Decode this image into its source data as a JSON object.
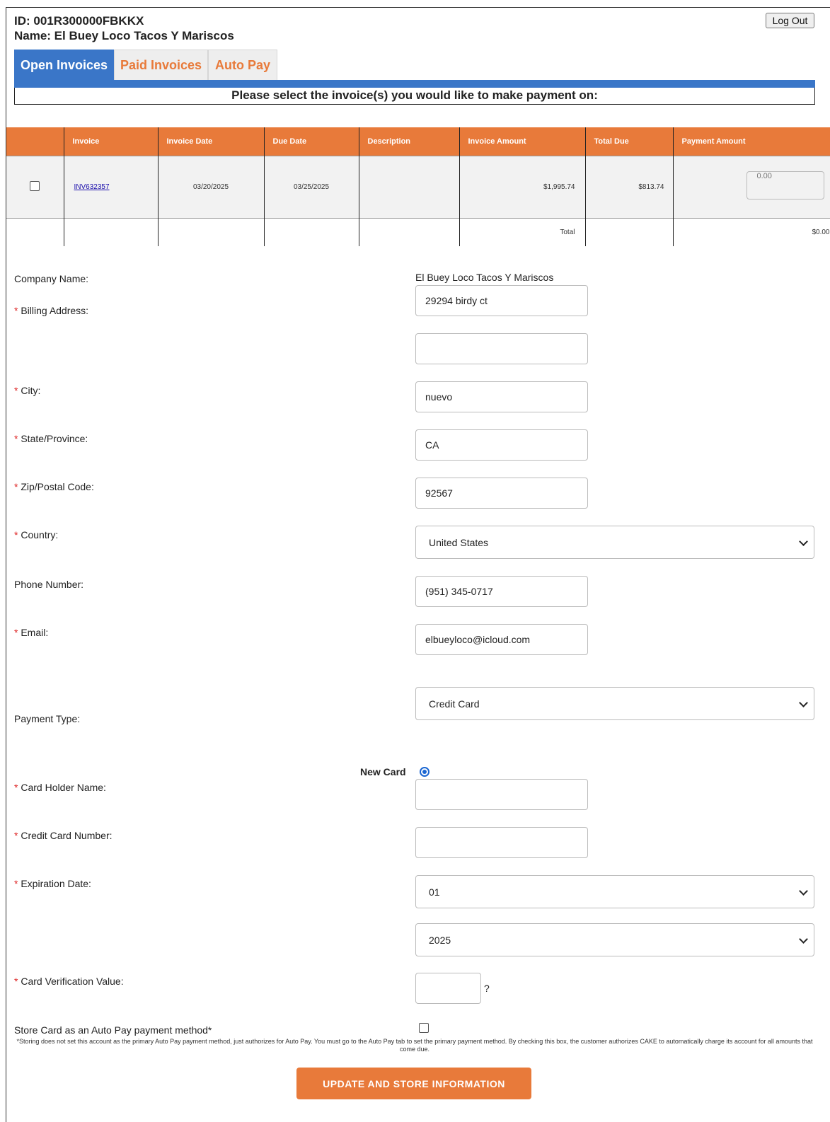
{
  "header": {
    "id_text": "ID: 001R300000FBKKX",
    "name_text": "Name: El Buey Loco Tacos Y Mariscos",
    "logout_label": "Log Out"
  },
  "tabs": [
    {
      "label": "Open Invoices",
      "active": true
    },
    {
      "label": "Paid Invoices",
      "active": false
    },
    {
      "label": "Auto Pay",
      "active": false
    }
  ],
  "instruction": "Please select the invoice(s) you would like to make payment on:",
  "invoice_table": {
    "columns": [
      "Invoice",
      "Invoice Date",
      "Due Date",
      "Description",
      "Invoice Amount",
      "Total Due",
      "Payment Amount"
    ],
    "rows": [
      {
        "invoice": "INV632357",
        "invoice_date": "03/20/2025",
        "due_date": "03/25/2025",
        "description": "",
        "invoice_amount": "$1,995.74",
        "total_due": "$813.74",
        "payment_amount": "0.00",
        "selected": false
      }
    ],
    "total_label": "Total",
    "total_value": "$0.00"
  },
  "form": {
    "company_name_label": "Company Name:",
    "company_name_value": "El Buey Loco Tacos Y Mariscos",
    "required_mark": "*",
    "billing_address_label": "Billing Address:",
    "billing_address_1": "29294 birdy ct",
    "billing_address_2": "",
    "city_label": "City:",
    "city_value": "nuevo",
    "state_label": "State/Province:",
    "state_value": "CA",
    "zip_label": "Zip/Postal Code:",
    "zip_value": "92567",
    "country_label": "Country:",
    "country_value": "United States",
    "phone_label": "Phone Number:",
    "phone_value": "(951) 345-0717",
    "email_label": "Email:",
    "email_value": "elbueyloco@icloud.com",
    "payment_type_label": "Payment Type:",
    "payment_type_value": "Credit Card",
    "new_card_label": "New Card",
    "card_holder_label": "Card Holder Name:",
    "card_holder_value": "",
    "cc_number_label": "Credit Card Number:",
    "cc_number_value": "",
    "expiration_label": "Expiration Date:",
    "exp_month": "01",
    "exp_year": "2025",
    "cvv_label": "Card Verification Value:",
    "cvv_help": "?",
    "store_card_label": "Store Card as an Auto Pay payment method*",
    "store_note": "*Storing does not set this account as the primary Auto Pay payment method, just authorizes for Auto Pay. You must go to the Auto Pay tab to set the primary payment method. By checking this box, the customer authorizes CAKE to automatically charge its account for all amounts that come due.",
    "submit_label": "UPDATE AND STORE INFORMATION"
  }
}
